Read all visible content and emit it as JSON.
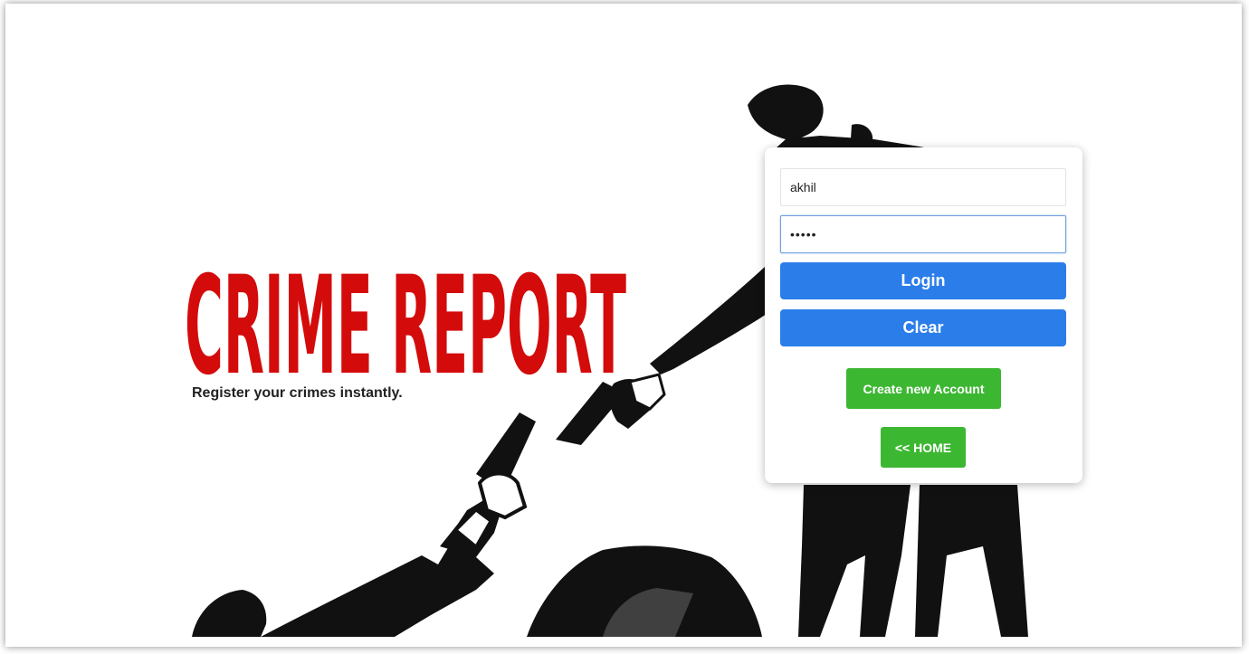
{
  "branding": {
    "logo_text": "CRIME REPORT",
    "tagline": "Register your crimes instantly.",
    "logo_color": "#d40b0b"
  },
  "login_form": {
    "username_value": "akhil",
    "password_value": "•••••",
    "login_label": "Login",
    "clear_label": "Clear",
    "create_account_label": "Create new Account",
    "home_label": "<< HOME"
  },
  "colors": {
    "primary_blue": "#2b7de9",
    "action_green": "#3cb731",
    "silhouette": "#111111"
  }
}
